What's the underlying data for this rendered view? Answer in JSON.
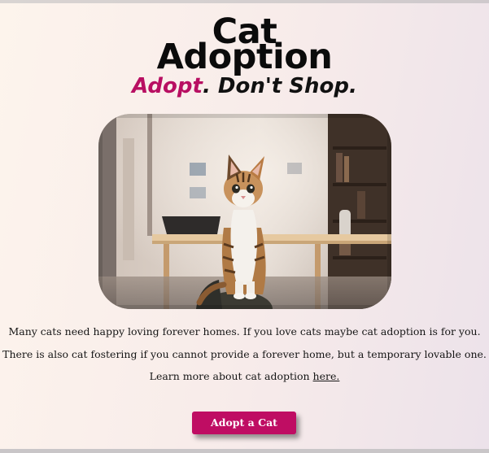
{
  "header": {
    "title_line1": "Cat",
    "title_line2": "Adoption",
    "tagline_accent": "Adopt",
    "tagline_rest": ". Don't Shop."
  },
  "hero_image": {
    "subject": "kitten",
    "icon": "cat-photo"
  },
  "content": {
    "paragraph1": "Many cats need happy loving forever homes. If you love cats maybe cat adoption is for you.",
    "paragraph2": "There is also cat fostering if you cannot provide a forever home, but a temporary lovable one.",
    "paragraph3_prefix": "Learn more about cat adoption ",
    "learn_more_link": "here."
  },
  "cta": {
    "label": "Adopt a Cat"
  },
  "colors": {
    "accent": "#b80f62",
    "button": "#bf0d63",
    "text": "#111111"
  }
}
